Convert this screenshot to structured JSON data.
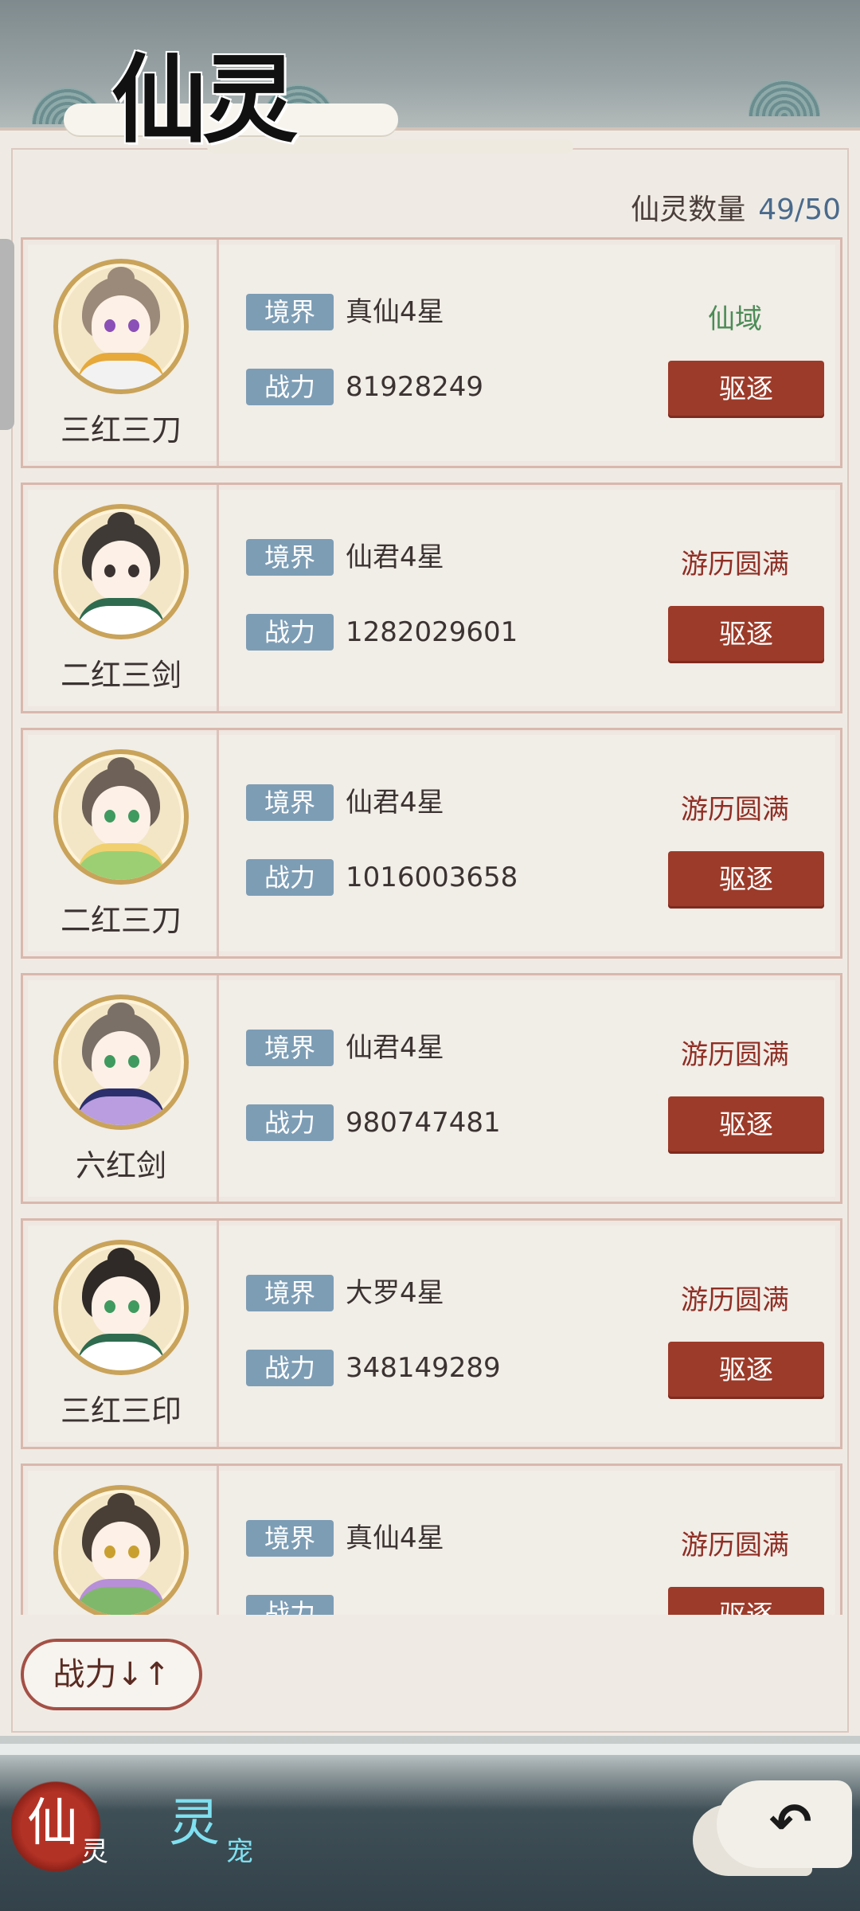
{
  "header": {
    "title": "仙灵"
  },
  "count": {
    "label": "仙灵数量",
    "value": "49/50"
  },
  "labels": {
    "realm_tag": "境界",
    "power_tag": "战力",
    "expel": "驱逐"
  },
  "spirits": [
    {
      "name": "三红三刀",
      "realm": "真仙4星",
      "power": "81928249",
      "status": "仙域",
      "status_color": "#4b8c56",
      "hair": "#9b8a79",
      "eye": "#8b4fb8",
      "outfit": "#f2f2f2",
      "accent": "#e6a93a"
    },
    {
      "name": "二红三剑",
      "realm": "仙君4星",
      "power": "1282029601",
      "status": "游历圆满",
      "status_color": "#8f2e24",
      "hair": "#3f3a36",
      "eye": "#3b3331",
      "outfit": "#ffffff",
      "accent": "#2f6b4f"
    },
    {
      "name": "二红三刀",
      "realm": "仙君4星",
      "power": "1016003658",
      "status": "游历圆满",
      "status_color": "#8f2e24",
      "hair": "#6e6258",
      "eye": "#3f9a5f",
      "outfit": "#9ccf73",
      "accent": "#f0d070"
    },
    {
      "name": "六红剑",
      "realm": "仙君4星",
      "power": "980747481",
      "status": "游历圆满",
      "status_color": "#8f2e24",
      "hair": "#7a7068",
      "eye": "#3f9a5f",
      "outfit": "#b99de0",
      "accent": "#2b2f6b"
    },
    {
      "name": "三红三印",
      "realm": "大罗4星",
      "power": "348149289",
      "status": "游历圆满",
      "status_color": "#8f2e24",
      "hair": "#2f2a27",
      "eye": "#3f9a5f",
      "outfit": "#ffffff",
      "accent": "#2f6b4f"
    },
    {
      "name": "",
      "realm": "真仙4星",
      "power": "",
      "status": "游历圆满",
      "status_color": "#8f2e24",
      "hair": "#4a3f36",
      "eye": "#c9a030",
      "outfit": "#7fb86a",
      "accent": "#b78fd8"
    }
  ],
  "sort": {
    "label": "战力↓↑"
  },
  "bottom_tabs": [
    {
      "big": "仙",
      "small": "灵",
      "active": true
    },
    {
      "big": "灵",
      "small": "宠",
      "active": false
    }
  ],
  "icons": {
    "back": "back-arrow-icon"
  },
  "colors": {
    "expel": "#9c3b2a",
    "tag": "#7d9db5",
    "count_value": "#4a6a8c"
  }
}
